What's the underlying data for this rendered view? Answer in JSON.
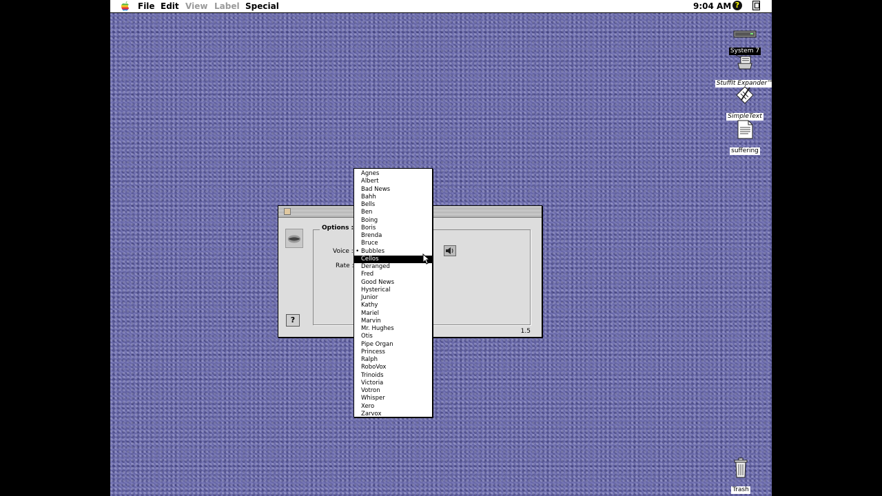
{
  "menubar": {
    "items": [
      {
        "label": "File",
        "enabled": true
      },
      {
        "label": "Edit",
        "enabled": true
      },
      {
        "label": "View",
        "enabled": false
      },
      {
        "label": "Label",
        "enabled": false
      },
      {
        "label": "Special",
        "enabled": true
      }
    ],
    "clock": "9:04 AM",
    "help_icon": "?"
  },
  "desktop_icons": [
    {
      "label": "System 7",
      "icon": "hard-drive-icon",
      "selected": true
    },
    {
      "label": "StuffIt Expander™",
      "icon": "stuffit-icon",
      "selected": false
    },
    {
      "label": "SimpleText",
      "icon": "simpletext-icon",
      "selected": false
    },
    {
      "label": "suffering",
      "icon": "document-icon",
      "selected": false
    },
    {
      "label": "Trash",
      "icon": "trash-icon",
      "selected": false
    }
  ],
  "window": {
    "options_label": "Options :",
    "voice_label": "Voice :",
    "rate_label": "Rate :",
    "help_button": "?",
    "version": "1.5"
  },
  "voice_menu": {
    "checked": "Bubbles",
    "highlighted": "Cellos",
    "items": [
      "Agnes",
      "Albert",
      "Bad News",
      "Bahh",
      "Bells",
      "Ben",
      "Boing",
      "Boris",
      "Brenda",
      "Bruce",
      "Bubbles",
      "Cellos",
      "Deranged",
      "Fred",
      "Good News",
      "Hysterical",
      "Junior",
      "Kathy",
      "Mariel",
      "Marvin",
      "Mr. Hughes",
      "Otis",
      "Pipe Organ",
      "Princess",
      "Ralph",
      "RoboVox",
      "Trinoids",
      "Victoria",
      "Votron",
      "Whisper",
      "Xero",
      "Zarvox"
    ]
  }
}
